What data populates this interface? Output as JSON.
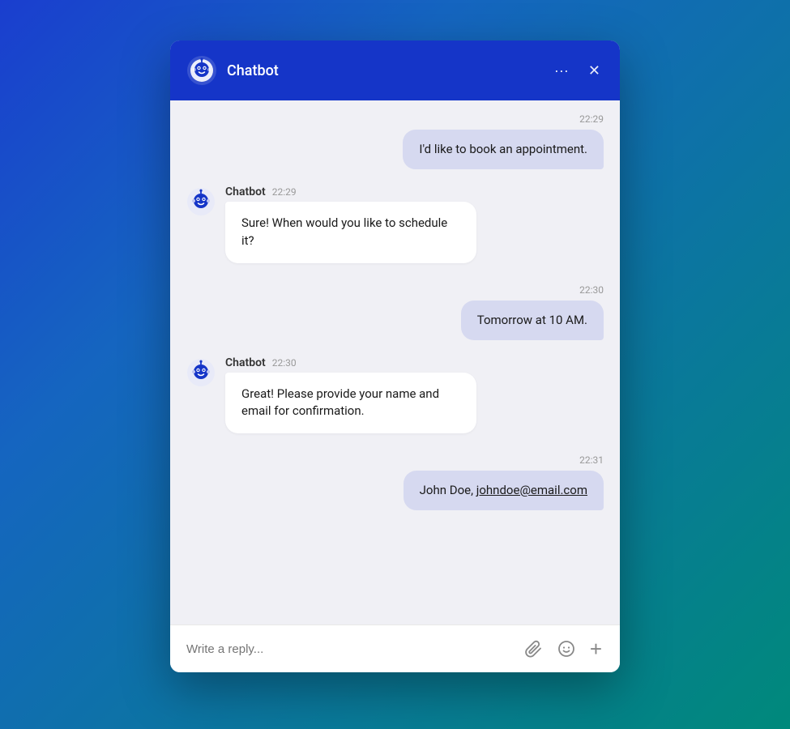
{
  "header": {
    "title": "Chatbot",
    "more_icon": "···",
    "close_icon": "✕"
  },
  "messages": [
    {
      "type": "timestamp",
      "value": "22:29"
    },
    {
      "type": "user",
      "text": "I'd like to book an appointment."
    },
    {
      "type": "bot",
      "name": "Chatbot",
      "time": "22:29",
      "text": "Sure! When would you like to schedule it?"
    },
    {
      "type": "timestamp",
      "value": "22:30"
    },
    {
      "type": "user",
      "text": "Tomorrow at 10 AM."
    },
    {
      "type": "bot",
      "name": "Chatbot",
      "time": "22:30",
      "text": "Great! Please provide your name and email for confirmation."
    },
    {
      "type": "timestamp",
      "value": "22:31"
    },
    {
      "type": "user_email",
      "text": "John Doe, ",
      "email": "johndoe@email.com"
    }
  ],
  "input": {
    "placeholder": "Write a reply...",
    "attach_icon": "📎",
    "emoji_icon": "🙂",
    "add_icon": "+"
  }
}
